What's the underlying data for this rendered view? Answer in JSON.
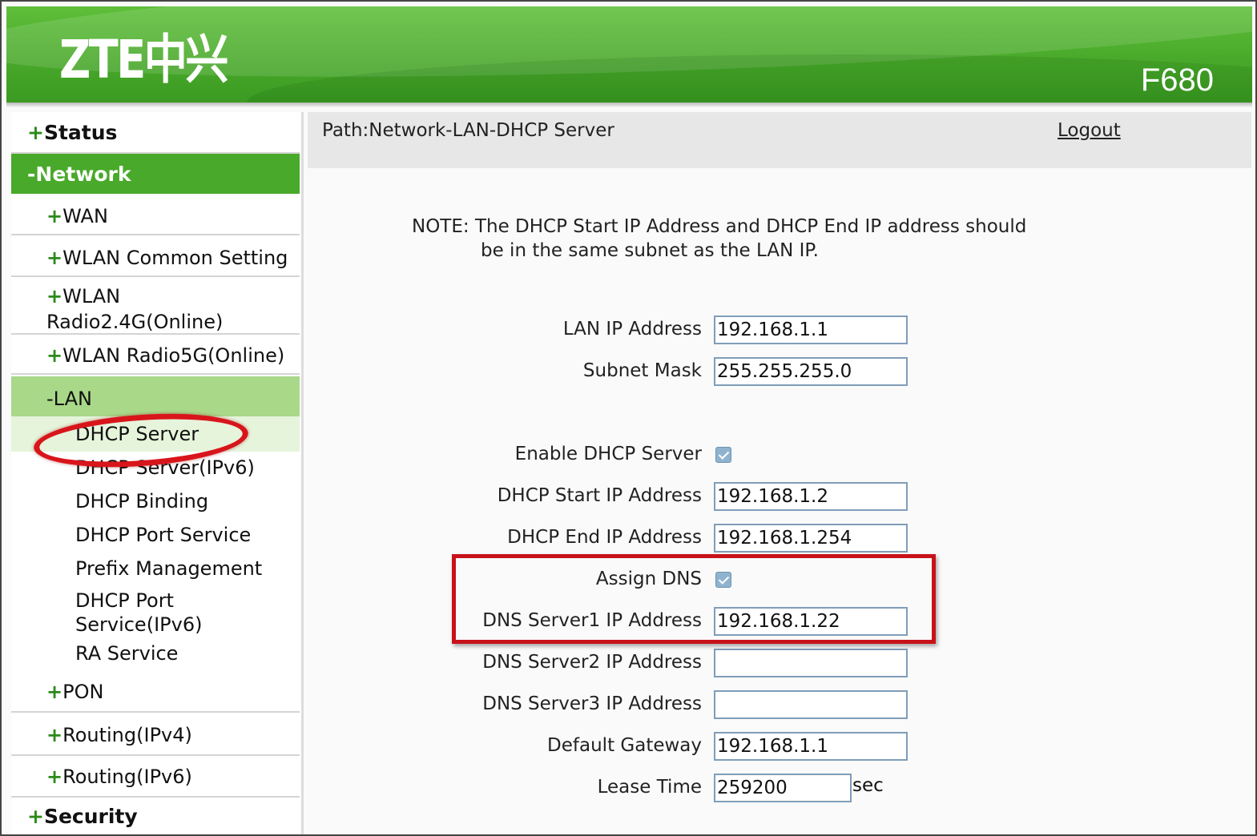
{
  "header": {
    "logo": "ZTE中兴",
    "model": "F680"
  },
  "sidebar": {
    "items": [
      {
        "label": "Status",
        "prefix": "+"
      },
      {
        "label": "Network",
        "prefix": "-"
      },
      {
        "label": "WAN",
        "prefix": "+"
      },
      {
        "label": "WLAN Common Setting",
        "prefix": "+"
      },
      {
        "label": "WLAN",
        "label2": "Radio2.4G(Online)",
        "prefix": "+"
      },
      {
        "label": "WLAN Radio5G(Online)",
        "prefix": "+"
      },
      {
        "label": "LAN",
        "prefix": "-"
      },
      {
        "label": "DHCP Server"
      },
      {
        "label": "DHCP Server(IPv6)"
      },
      {
        "label": "DHCP Binding"
      },
      {
        "label": "DHCP Port Service"
      },
      {
        "label": "Prefix Management"
      },
      {
        "label": "DHCP Port",
        "label2": "Service(IPv6)"
      },
      {
        "label": "RA Service"
      },
      {
        "label": "PON",
        "prefix": "+"
      },
      {
        "label": "Routing(IPv4)",
        "prefix": "+"
      },
      {
        "label": "Routing(IPv6)",
        "prefix": "+"
      },
      {
        "label": "Security",
        "prefix": "+"
      }
    ]
  },
  "pathbar": {
    "path": "Path:Network-LAN-DHCP Server",
    "logout": "Logout"
  },
  "note": {
    "line1": "NOTE: The DHCP Start IP Address and DHCP End IP address should",
    "line2": "be in the same subnet as the LAN IP."
  },
  "form": {
    "lan_ip": {
      "label": "LAN IP Address",
      "value": "192.168.1.1"
    },
    "subnet": {
      "label": "Subnet Mask",
      "value": "255.255.255.0"
    },
    "enable_dhcp": {
      "label": "Enable DHCP Server",
      "checked": true
    },
    "start_ip": {
      "label": "DHCP Start IP Address",
      "value": "192.168.1.2"
    },
    "end_ip": {
      "label": "DHCP End IP Address",
      "value": "192.168.1.254"
    },
    "assign_dns": {
      "label": "Assign DNS",
      "checked": true
    },
    "dns1": {
      "label": "DNS Server1 IP Address",
      "value": "192.168.1.22"
    },
    "dns2": {
      "label": "DNS Server2 IP Address",
      "value": ""
    },
    "dns3": {
      "label": "DNS Server3 IP Address",
      "value": ""
    },
    "gateway": {
      "label": "Default Gateway",
      "value": "192.168.1.1"
    },
    "lease": {
      "label": "Lease Time",
      "value": "259200",
      "unit": "sec"
    }
  },
  "colors": {
    "brand_green": "#49a92a",
    "annotation_red": "#d8151b"
  }
}
